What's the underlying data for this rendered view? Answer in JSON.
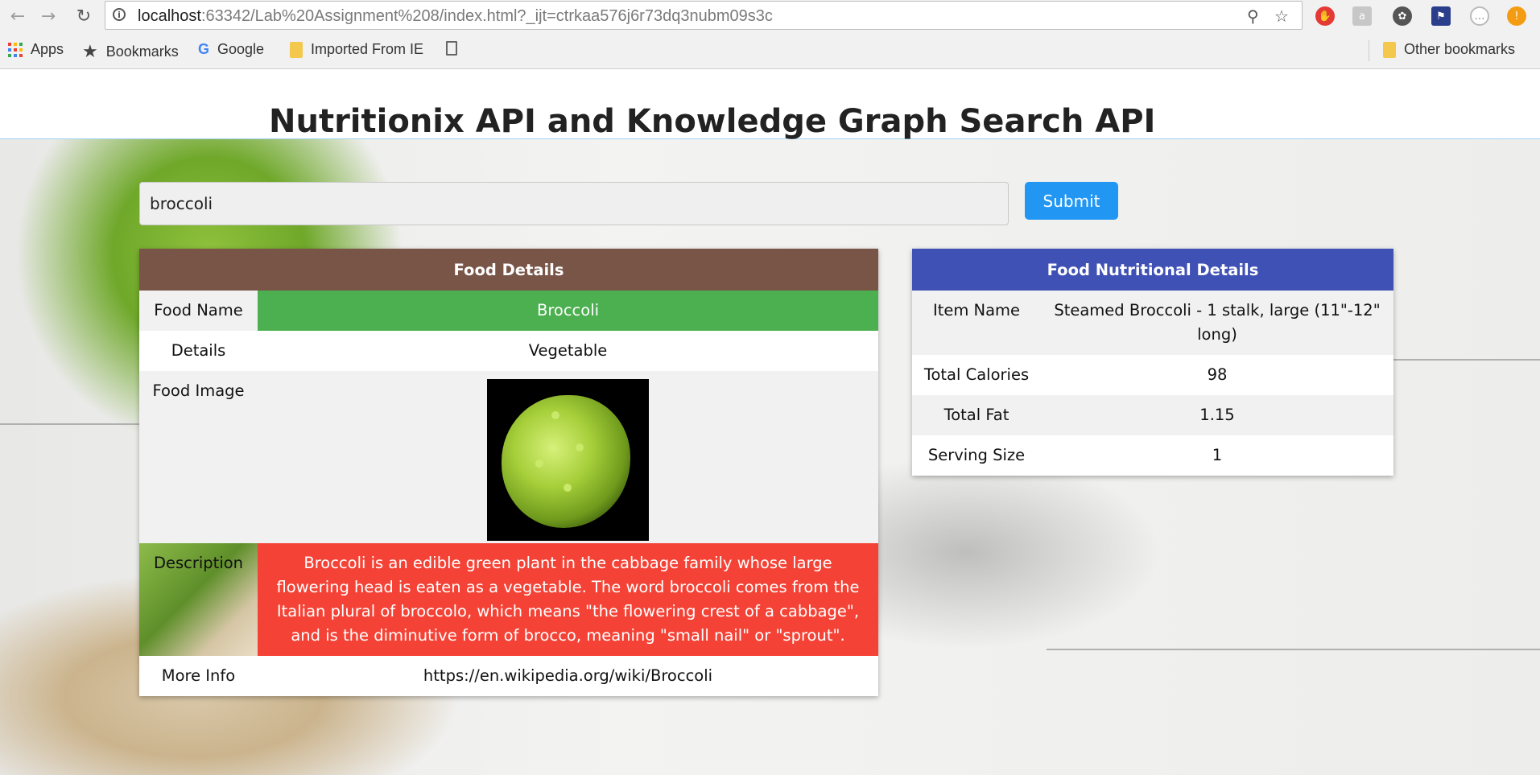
{
  "browser": {
    "url_host": "localhost",
    "url_rest": ":63342/Lab%20Assignment%208/index.html?_ijt=ctrkaa576j6r73dq3nubm09s3c",
    "bookmarks": [
      {
        "label": "Apps",
        "icon": "apps-grid-icon"
      },
      {
        "label": "Bookmarks",
        "icon": "star-icon"
      },
      {
        "label": "Google",
        "icon": "google-icon"
      },
      {
        "label": "Imported From IE",
        "icon": "folder-icon"
      },
      {
        "label": "",
        "icon": "page-icon"
      }
    ],
    "other_bookmarks": "Other bookmarks"
  },
  "page": {
    "title": "Nutritionix API and Knowledge Graph Search API",
    "search_value": "broccoli",
    "submit_label": "Submit"
  },
  "food_details": {
    "header": "Food Details",
    "rows": [
      {
        "label": "Food Name",
        "value": "Broccoli"
      },
      {
        "label": "Details",
        "value": "Vegetable"
      },
      {
        "label": "Food Image",
        "value": ""
      },
      {
        "label": "Description",
        "value": "Broccoli is an edible green plant in the cabbage family whose large flowering head is eaten as a vegetable. The word broccoli comes from the Italian plural of broccolo, which means \"the flowering crest of a cabbage\", and is the diminutive form of brocco, meaning \"small nail\" or \"sprout\"."
      },
      {
        "label": "More Info",
        "value": "https://en.wikipedia.org/wiki/Broccoli"
      }
    ]
  },
  "nutrition": {
    "header": "Food Nutritional Details",
    "rows": [
      {
        "label": "Item Name",
        "value": "Steamed Broccoli - 1 stalk, large (11\"-12\" long)"
      },
      {
        "label": "Total Calories",
        "value": "98"
      },
      {
        "label": "Total Fat",
        "value": "1.15"
      },
      {
        "label": "Serving Size",
        "value": "1"
      }
    ]
  },
  "colors": {
    "food_header": "#795548",
    "food_name_cell": "#4caf50",
    "description_cell": "#f44336",
    "nutrition_header": "#3f51b5",
    "submit_button": "#2196f3"
  }
}
